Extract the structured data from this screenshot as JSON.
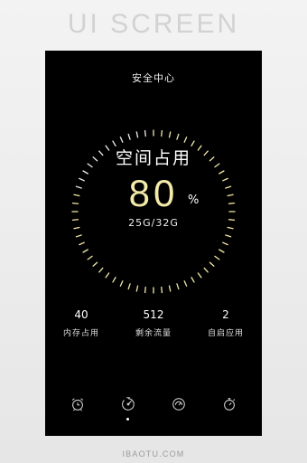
{
  "banner": "UI SCREEN",
  "footer": "IBAOTU.COM",
  "app": {
    "title": "安全中心",
    "gauge": {
      "label": "空间占用",
      "value": "80",
      "unit": "%",
      "detail": "25G/32G",
      "fraction": 0.8
    },
    "stats": [
      {
        "value": "40",
        "label": "内存占用"
      },
      {
        "value": "512",
        "label": "剩余流量"
      },
      {
        "value": "2",
        "label": "自启应用"
      }
    ],
    "nav": [
      {
        "icon": "alarm-clock-icon",
        "active": false
      },
      {
        "icon": "speed-clock-icon",
        "active": true
      },
      {
        "icon": "speedometer-icon",
        "active": false
      },
      {
        "icon": "stopwatch-icon",
        "active": false
      }
    ]
  },
  "colors": {
    "background": "#000000",
    "accent": "#f3e9a8",
    "text": "#ffffff"
  }
}
